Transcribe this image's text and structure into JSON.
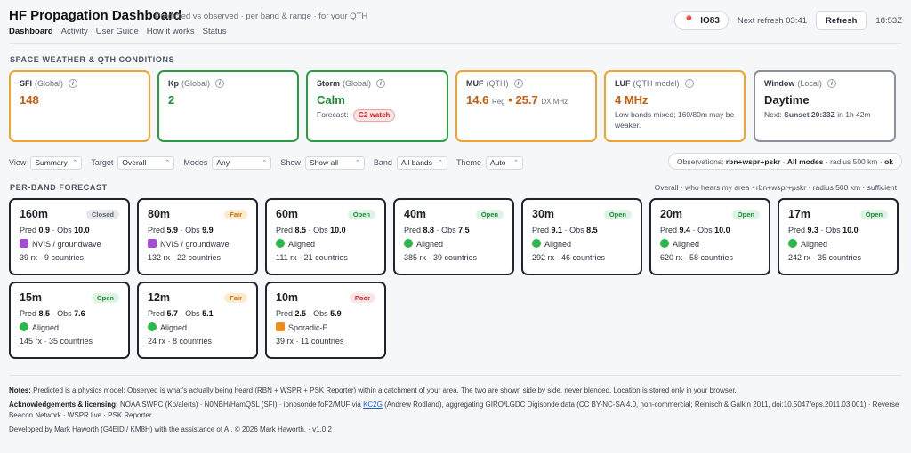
{
  "header": {
    "title": "HF Propagation Dashboard",
    "subtitle": "Predicted vs observed · per band & range · for your QTH",
    "nav": [
      "Dashboard",
      "Activity",
      "User Guide",
      "How it works",
      "Status"
    ],
    "locator": "IO83",
    "next_refresh": "Next refresh 03:41",
    "refresh_label": "Refresh",
    "clock": "18:53Z"
  },
  "conditions": {
    "section_title": "SPACE WEATHER & QTH CONDITIONS",
    "sfi": {
      "label": "SFI",
      "sub": "(Global)",
      "value": "148"
    },
    "kp": {
      "label": "Kp",
      "sub": "(Global)",
      "value": "2"
    },
    "storm": {
      "label": "Storm",
      "sub": "(Global)",
      "value": "Calm",
      "forecast_label": "Forecast:",
      "forecast_badge": "G2 watch"
    },
    "muf": {
      "label": "MUF",
      "sub": "(QTH)",
      "reg_value": "14.6",
      "reg_label": "Reg",
      "sep": "•",
      "dx_value": "25.7",
      "dx_label": "DX MHz"
    },
    "luf": {
      "label": "LUF",
      "sub": "(QTH model)",
      "value": "4 MHz",
      "note": "Low bands mixed; 160/80m may be weaker."
    },
    "window": {
      "label": "Window",
      "sub": "(Local)",
      "value": "Daytime",
      "next_label": "Next:",
      "next_value": "Sunset 20:33Z",
      "next_suffix": "in 1h 42m"
    }
  },
  "controls": {
    "view": {
      "label": "View",
      "value": "Summary"
    },
    "target": {
      "label": "Target",
      "value": "Overall"
    },
    "modes": {
      "label": "Modes",
      "value": "Any"
    },
    "show": {
      "label": "Show",
      "value": "Show all"
    },
    "band": {
      "label": "Band",
      "value": "All bands"
    },
    "theme": {
      "label": "Theme",
      "value": "Auto"
    },
    "observations": {
      "prefix": "Observations:",
      "sources": "rbn+wspr+pskr",
      "sep1": "·",
      "modes": "All modes",
      "sep2": "·",
      "radius": "radius 500 km",
      "sep3": "·",
      "status": "ok"
    }
  },
  "bands": {
    "section_title": "PER-BAND FORECAST",
    "meta": "Overall · who hears my area · rbn+wspr+pskr · radius 500 km · sufficient",
    "pred_label": "Pred",
    "obs_label": "Obs",
    "sep": "·",
    "items": [
      {
        "name": "160m",
        "status": "Closed",
        "pred": "0.9",
        "obs": "10.0",
        "mode": "NVIS / groundwave",
        "stats": "39 rx · 9 countries"
      },
      {
        "name": "80m",
        "status": "Fair",
        "pred": "5.9",
        "obs": "9.9",
        "mode": "NVIS / groundwave",
        "stats": "132 rx · 22 countries"
      },
      {
        "name": "60m",
        "status": "Open",
        "pred": "8.5",
        "obs": "10.0",
        "mode": "Aligned",
        "stats": "111 rx · 21 countries"
      },
      {
        "name": "40m",
        "status": "Open",
        "pred": "8.8",
        "obs": "7.5",
        "mode": "Aligned",
        "stats": "385 rx · 39 countries"
      },
      {
        "name": "30m",
        "status": "Open",
        "pred": "9.1",
        "obs": "8.5",
        "mode": "Aligned",
        "stats": "292 rx · 46 countries"
      },
      {
        "name": "20m",
        "status": "Open",
        "pred": "9.4",
        "obs": "10.0",
        "mode": "Aligned",
        "stats": "620 rx · 58 countries"
      },
      {
        "name": "17m",
        "status": "Open",
        "pred": "9.3",
        "obs": "10.0",
        "mode": "Aligned",
        "stats": "242 rx · 35 countries"
      },
      {
        "name": "15m",
        "status": "Open",
        "pred": "8.5",
        "obs": "7.6",
        "mode": "Aligned",
        "stats": "145 rx · 35 countries"
      },
      {
        "name": "12m",
        "status": "Fair",
        "pred": "5.7",
        "obs": "5.1",
        "mode": "Aligned",
        "stats": "24 rx · 8 countries"
      },
      {
        "name": "10m",
        "status": "Poor",
        "pred": "2.5",
        "obs": "5.9",
        "mode": "Sporadic-E",
        "stats": "39 rx · 11 countries"
      }
    ]
  },
  "footer": {
    "notes_label": "Notes:",
    "notes_text": "Predicted is a physics model; Observed is what's actually being heard (RBN + WSPR + PSK Reporter) within a catchment of your area. The two are shown side by side, never blended. Location is stored only in your browser.",
    "ack_label": "Acknowledgements & licensing:",
    "ack_text_1": "NOAA SWPC (Kp/alerts) · N0NBH/HamQSL (SFI) · ionosonde foF2/MUF via",
    "ack_link": "KC2G",
    "ack_text_2": "(Andrew Rodland), aggregating GIRO/LGDC Digisonde data (CC BY-NC-SA 4.0, non-commercial; Reinisch & Galkin 2011, doi:10.5047/eps.2011.03.001) · Reverse Beacon Network · WSPR.live · PSK Reporter.",
    "credit": "Developed by Mark Haworth (G4EID / KM8H) with the assistance of AI. © 2026 Mark Haworth. · v1.0.2"
  },
  "colors": {
    "open": "#2a9d43",
    "fair": "#efa332",
    "closed": "#8a8f99",
    "poor": "#df4545"
  }
}
